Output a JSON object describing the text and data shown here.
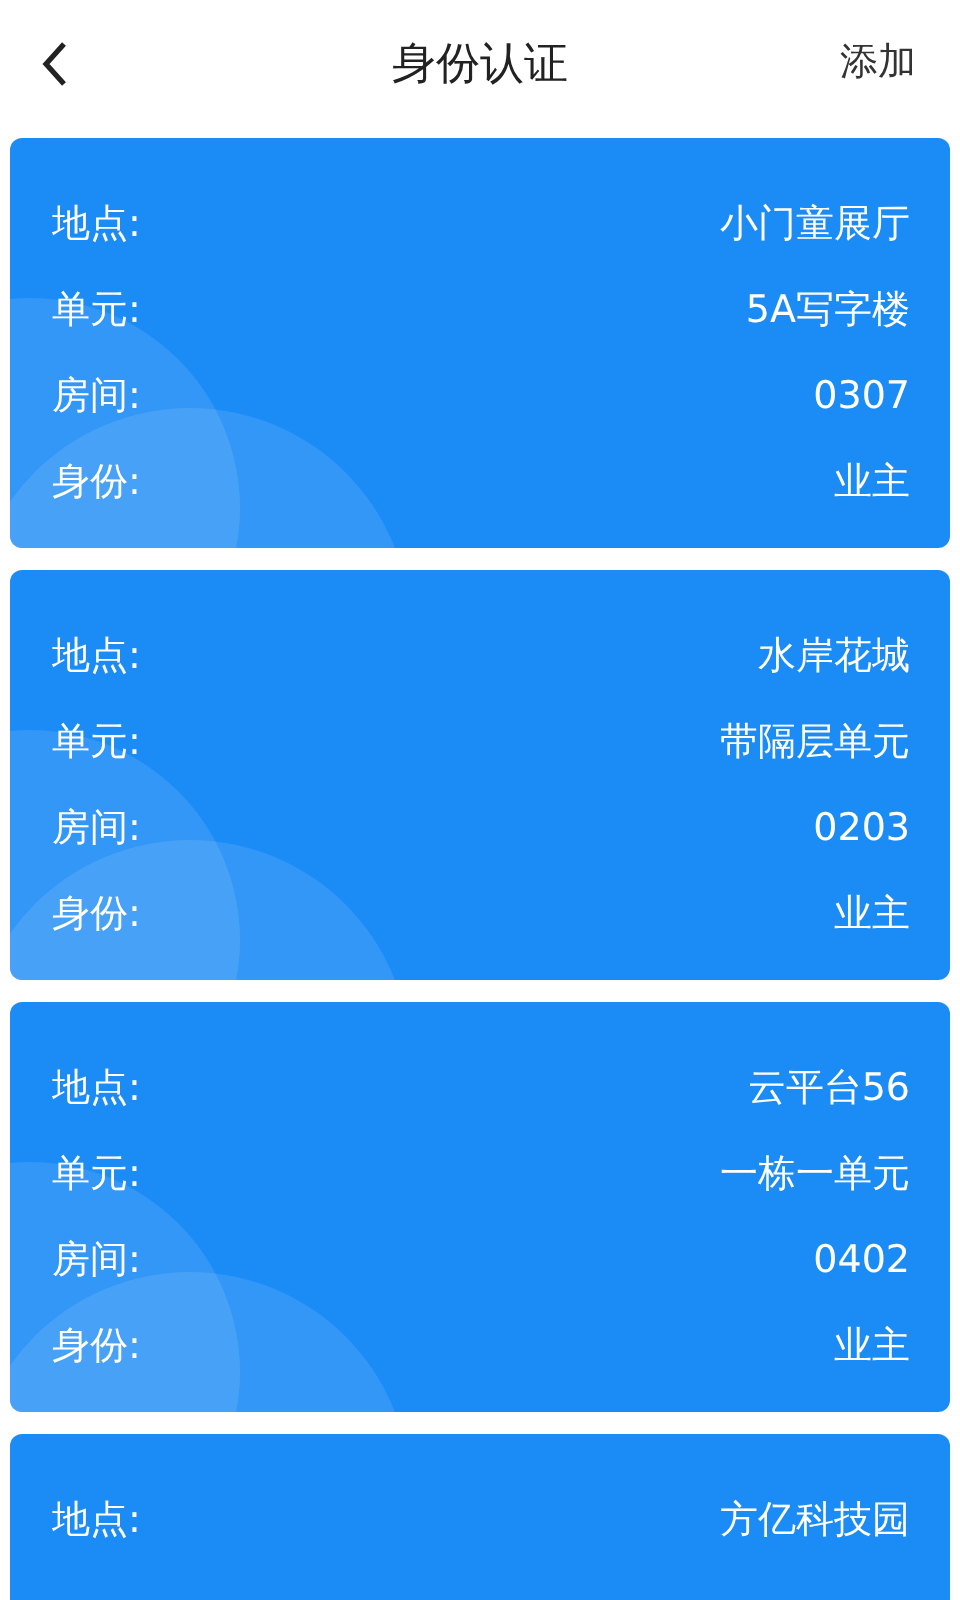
{
  "header": {
    "title": "身份认证",
    "action": "添加"
  },
  "cards": [
    {
      "rows": [
        {
          "label": "地点:",
          "value": "小门童展厅"
        },
        {
          "label": "单元:",
          "value": "5A写字楼"
        },
        {
          "label": "房间:",
          "value": "0307"
        },
        {
          "label": "身份:",
          "value": "业主"
        }
      ]
    },
    {
      "rows": [
        {
          "label": "地点:",
          "value": "水岸花城"
        },
        {
          "label": "单元:",
          "value": "带隔层单元"
        },
        {
          "label": "房间:",
          "value": "0203"
        },
        {
          "label": "身份:",
          "value": "业主"
        }
      ]
    },
    {
      "rows": [
        {
          "label": "地点:",
          "value": "云平台56"
        },
        {
          "label": "单元:",
          "value": "一栋一单元"
        },
        {
          "label": "房间:",
          "value": "0402"
        },
        {
          "label": "身份:",
          "value": "业主"
        }
      ]
    },
    {
      "rows": [
        {
          "label": "地点:",
          "value": "方亿科技园"
        }
      ]
    }
  ]
}
